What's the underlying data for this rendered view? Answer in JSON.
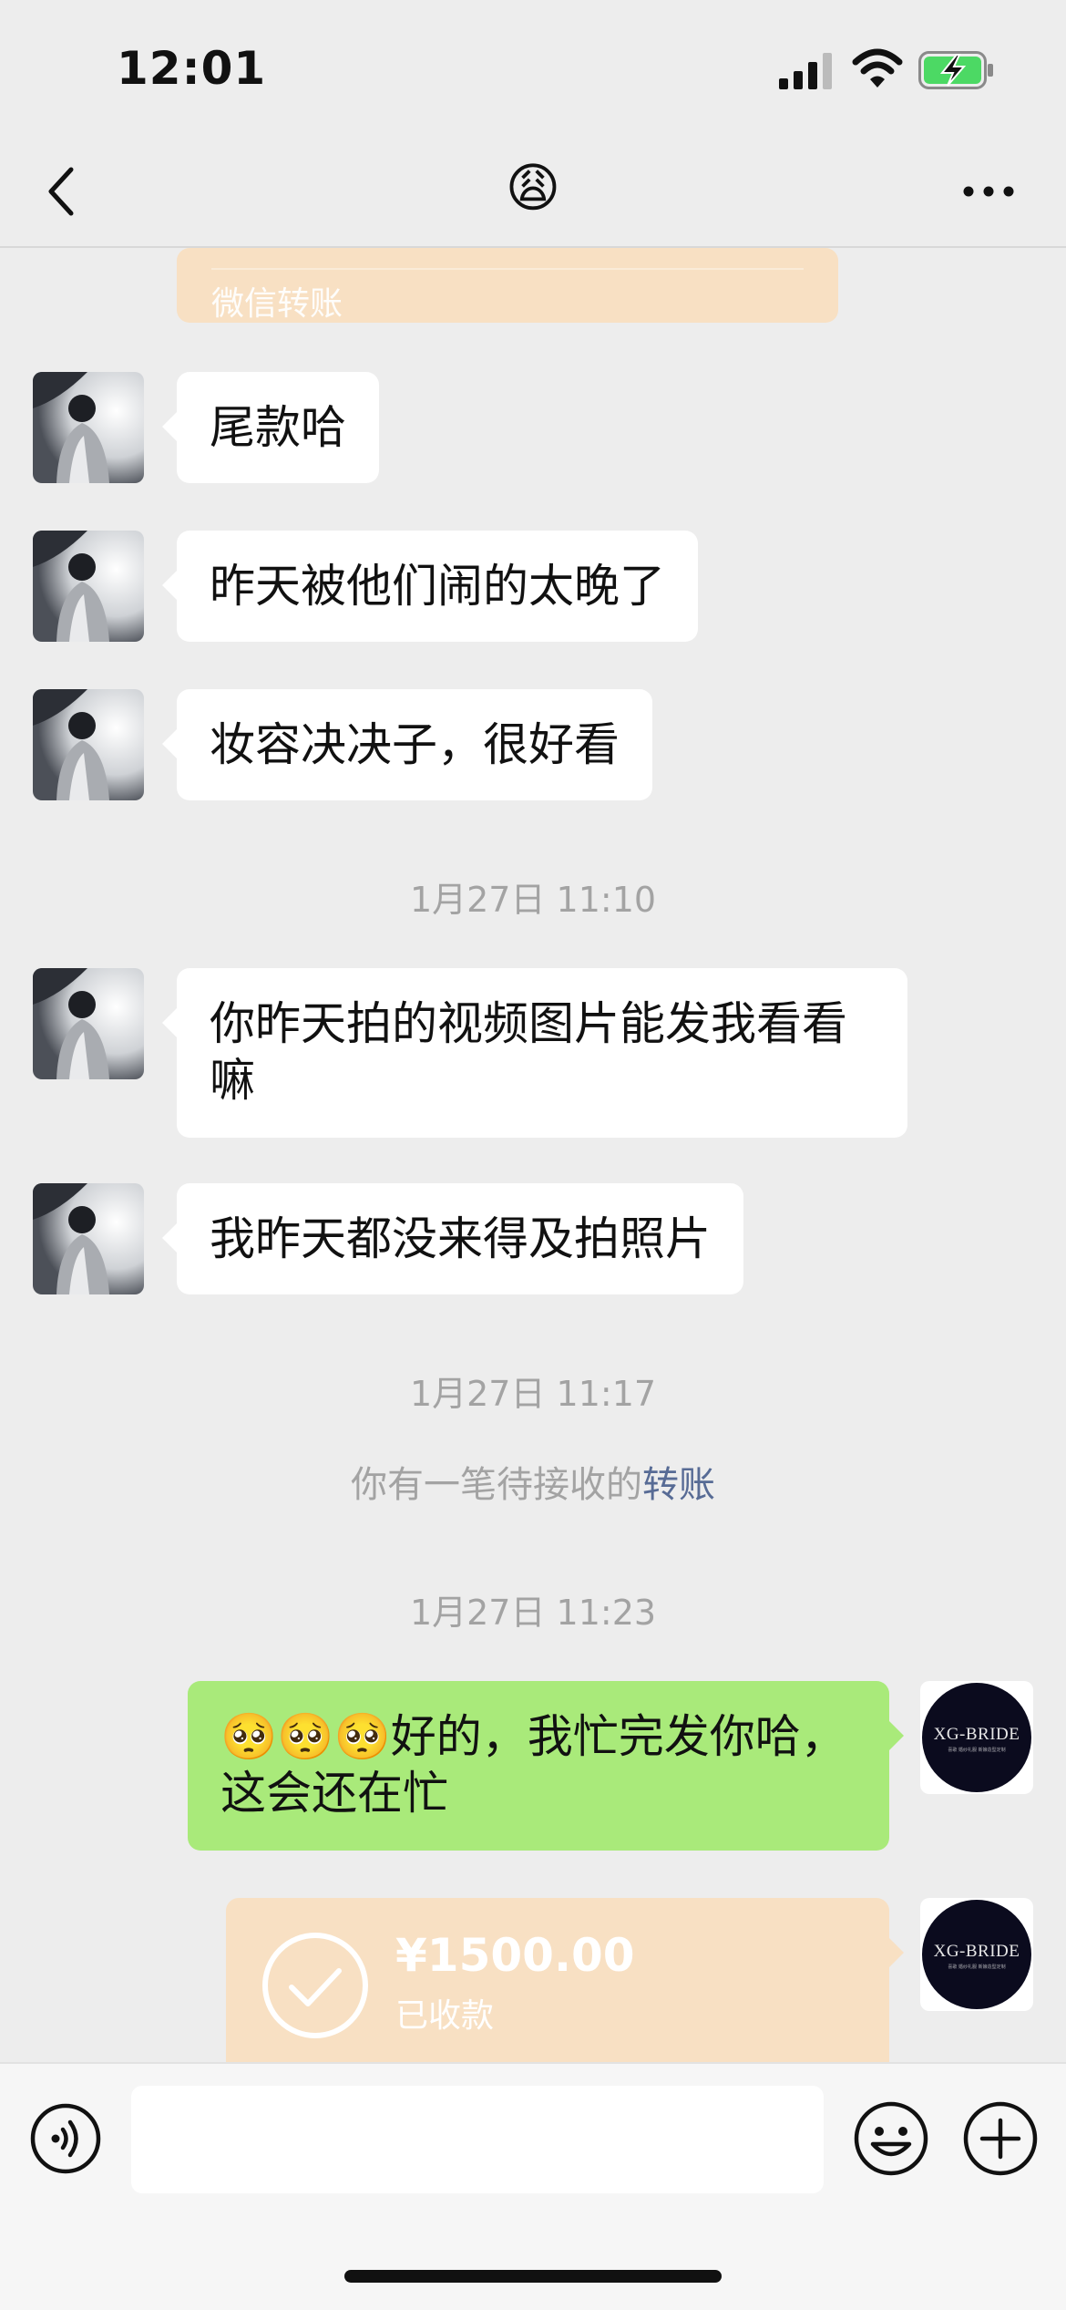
{
  "status_bar": {
    "time": "12:01"
  },
  "nav": {
    "title_emoji": "😩"
  },
  "chat": {
    "partial_transfer_label": "微信转账",
    "messages_before": [
      {
        "text": "尾款哈"
      },
      {
        "text": "昨天被他们闹的太晚了"
      },
      {
        "text": "妆容决决子，很好看"
      }
    ],
    "timestamp_1": "1月27日 11:10",
    "messages_after": [
      {
        "line1": "你昨天拍的视频图片能发我看看",
        "line2": "嘛"
      },
      {
        "text": "我昨天都没来得及拍照片"
      }
    ],
    "timestamp_2": "1月27日 11:17",
    "system_notice": {
      "prefix": "你有一笔待接收的",
      "link": "转账"
    },
    "timestamp_3": "1月27日 11:23",
    "my_message": {
      "emojis": "🥺🥺🥺",
      "line1": "好的，我忙完发你哈，",
      "line2": "这会还在忙"
    },
    "transfer": {
      "amount": "¥1500.00",
      "status": "已收款"
    },
    "my_avatar": {
      "logo_text": "XG-BRIDE",
      "logo_sub": "喜歌 婚纱礼服 新娘造型定制"
    }
  },
  "colors": {
    "background": "#ededed",
    "my_bubble": "#a9ea7a",
    "transfer_card": "#f8e0c3",
    "link": "#576b95"
  }
}
